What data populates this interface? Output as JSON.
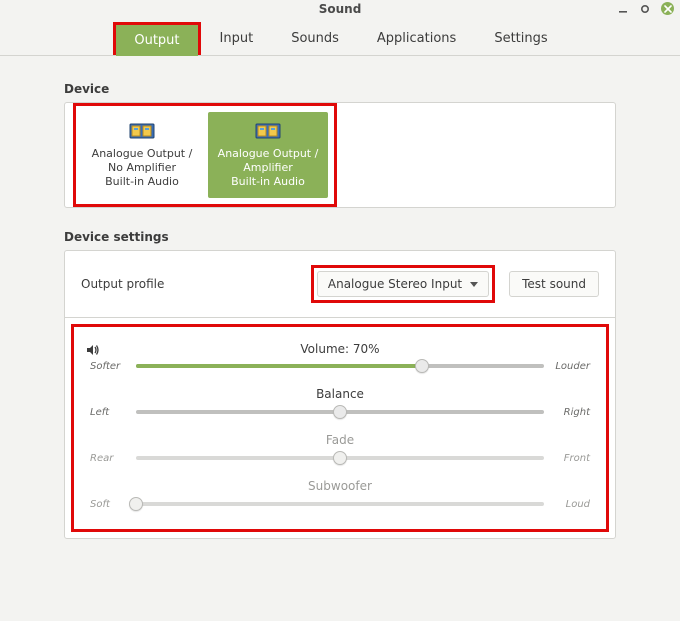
{
  "window": {
    "title": "Sound"
  },
  "tabs": {
    "output": "Output",
    "input": "Input",
    "sounds": "Sounds",
    "applications": "Applications",
    "settings": "Settings",
    "active": "output"
  },
  "device": {
    "section_label": "Device",
    "cards": [
      {
        "line1": "Analogue Output /",
        "line2": "No Amplifier",
        "line3": "Built-in Audio",
        "selected": false
      },
      {
        "line1": "Analogue Output /",
        "line2": "Amplifier",
        "line3": "Built-in Audio",
        "selected": true
      }
    ]
  },
  "device_settings": {
    "section_label": "Device settings",
    "profile_label": "Output profile",
    "profile_value": "Analogue Stereo Input",
    "test_sound": "Test sound"
  },
  "sliders": {
    "volume": {
      "title": "Volume: 70%",
      "left": "Softer",
      "right": "Louder",
      "value": 70,
      "enabled": true
    },
    "balance": {
      "title": "Balance",
      "left": "Left",
      "right": "Right",
      "value": 50,
      "enabled": true
    },
    "fade": {
      "title": "Fade",
      "left": "Rear",
      "right": "Front",
      "value": 50,
      "enabled": false
    },
    "subwoofer": {
      "title": "Subwoofer",
      "left": "Soft",
      "right": "Loud",
      "value": 0,
      "enabled": false
    }
  },
  "icons": {
    "speaker": "volume-icon",
    "soundcard": "sound-card-icon"
  }
}
